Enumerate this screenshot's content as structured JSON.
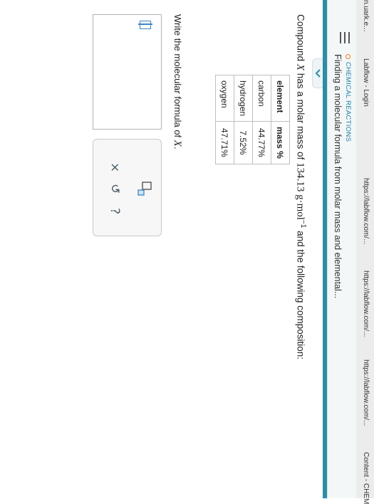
{
  "bookmarks": [
    "n.uark.e...",
    "Labflow - Login",
    "https://labflow.com/...",
    "https://labflow.com/...",
    "https://labflow.com/...",
    "Content - CHEM"
  ],
  "header": {
    "topic": "CHEMICAL REACTIONS",
    "title": "Finding a molecular formula from molar mass and elemental..."
  },
  "problem": {
    "prefix": "Compound",
    "var": "X",
    "mid": "has a molar mass of",
    "value": "134.13",
    "unit": "g·mol",
    "exp": "−1",
    "suffix": "and the following composition:"
  },
  "table": {
    "headers": [
      "element",
      "mass %"
    ],
    "rows": [
      [
        "carbon",
        "44.77%"
      ],
      [
        "hydrogen",
        "7.52%"
      ],
      [
        "oxygen",
        "47.71%"
      ]
    ]
  },
  "question": {
    "text": "Write the molecular formula of",
    "var": "X",
    "end": "."
  },
  "tools": {
    "clear": "×",
    "undo": "↺",
    "help": "?"
  },
  "colors": {
    "accent": "#2a8ea6",
    "topic": "#1d7fa6",
    "topic_dot": "#f5761a"
  }
}
